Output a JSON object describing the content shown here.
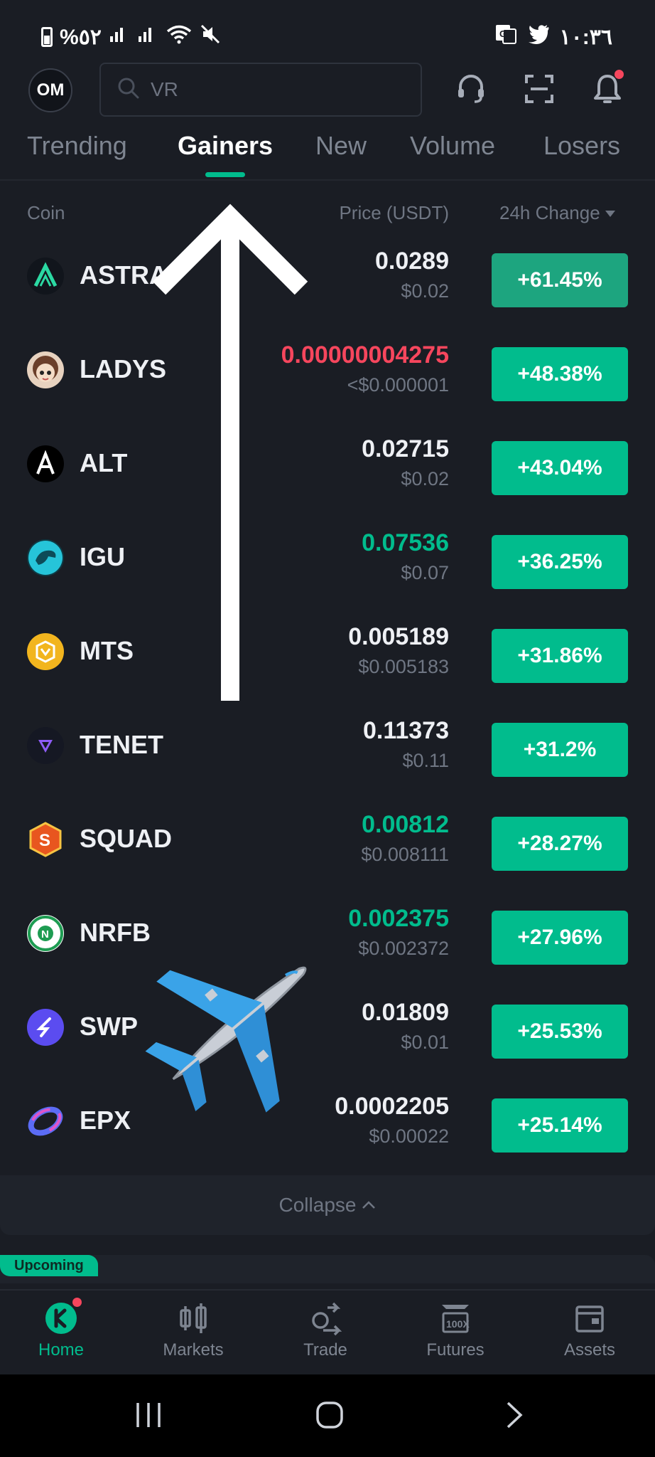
{
  "status_bar": {
    "left_text": "%٥٢",
    "time": "١٠:٣٦"
  },
  "header": {
    "avatar_initials": "OM",
    "search_placeholder": "VR"
  },
  "tabs": [
    {
      "label": "Trending"
    },
    {
      "label": "Gainers"
    },
    {
      "label": "New"
    },
    {
      "label": "Volume"
    },
    {
      "label": "Losers"
    }
  ],
  "columns": {
    "coin": "Coin",
    "price": "Price (USDT)",
    "change": "24h Change"
  },
  "rows": [
    {
      "symbol": "ASTRA",
      "price": "0.0289",
      "fiat": "$0.02",
      "change": "+61.45%",
      "price_color": "default",
      "icon": "astra-icon"
    },
    {
      "symbol": "LADYS",
      "price": "0.00000004275",
      "fiat": "<$0.000001",
      "change": "+48.38%",
      "price_color": "red",
      "icon": "ladys-icon"
    },
    {
      "symbol": "ALT",
      "price": "0.02715",
      "fiat": "$0.02",
      "change": "+43.04%",
      "price_color": "default",
      "icon": "alt-icon"
    },
    {
      "symbol": "IGU",
      "price": "0.07536",
      "fiat": "$0.07",
      "change": "+36.25%",
      "price_color": "green",
      "icon": "igu-icon"
    },
    {
      "symbol": "MTS",
      "price": "0.005189",
      "fiat": "$0.005183",
      "change": "+31.86%",
      "price_color": "default",
      "icon": "mts-icon"
    },
    {
      "symbol": "TENET",
      "price": "0.11373",
      "fiat": "$0.11",
      "change": "+31.2%",
      "price_color": "default",
      "icon": "tenet-icon"
    },
    {
      "symbol": "SQUAD",
      "price": "0.00812",
      "fiat": "$0.008111",
      "change": "+28.27%",
      "price_color": "green",
      "icon": "squad-icon"
    },
    {
      "symbol": "NRFB",
      "price": "0.002375",
      "fiat": "$0.002372",
      "change": "+27.96%",
      "price_color": "green",
      "icon": "nrfb-icon"
    },
    {
      "symbol": "SWP",
      "price": "0.01809",
      "fiat": "$0.01",
      "change": "+25.53%",
      "price_color": "default",
      "icon": "swp-icon"
    },
    {
      "symbol": "EPX",
      "price": "0.0002205",
      "fiat": "$0.00022",
      "change": "+25.14%",
      "price_color": "default",
      "icon": "epx-icon"
    }
  ],
  "collapse_label": "Collapse",
  "upcoming_label": "Upcoming",
  "bottom_nav": [
    {
      "label": "Home",
      "active": true
    },
    {
      "label": "Markets"
    },
    {
      "label": "Trade"
    },
    {
      "label": "Futures"
    },
    {
      "label": "Assets"
    }
  ],
  "colors": {
    "accent": "#01bc8d",
    "down": "#f6465d",
    "background": "#1a1d24"
  }
}
